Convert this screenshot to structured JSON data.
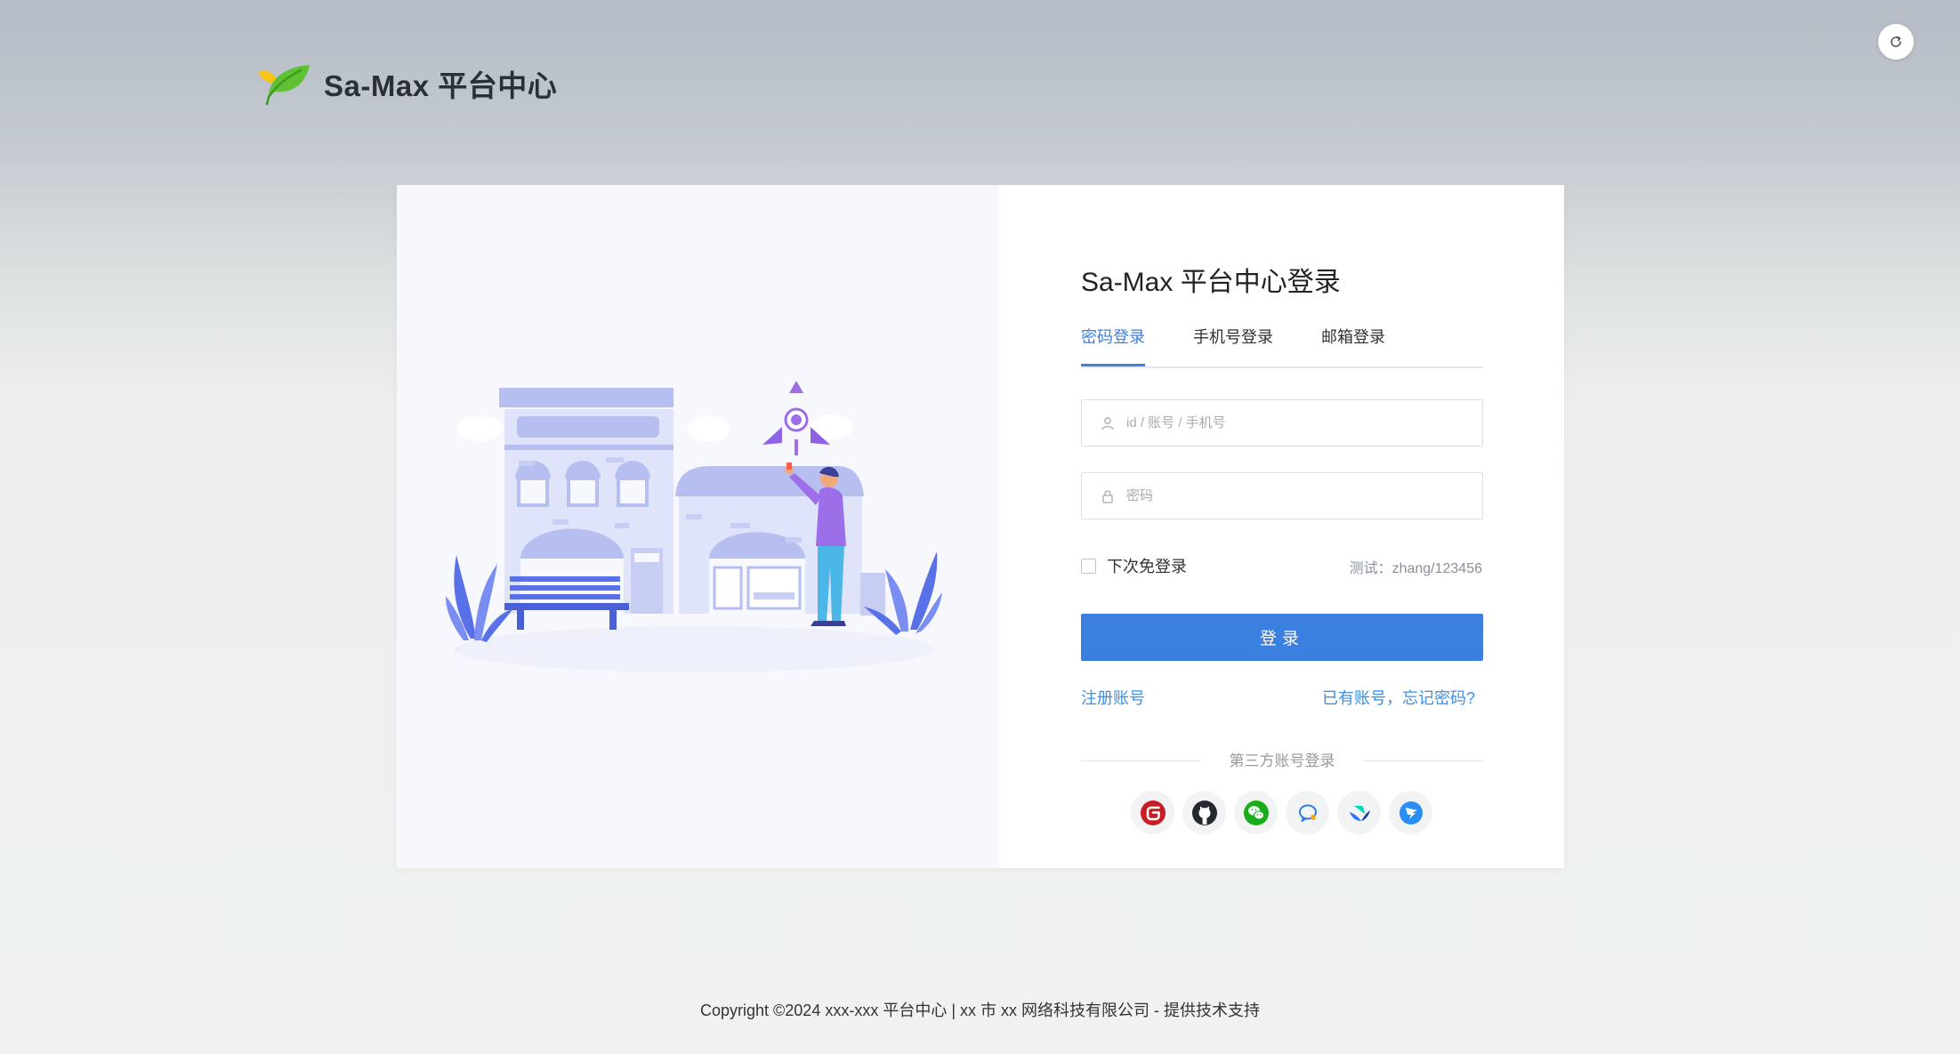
{
  "brand": {
    "name": "Sa-Max 平台中心"
  },
  "login": {
    "title": "Sa-Max 平台中心登录",
    "tabs": [
      {
        "label": "密码登录",
        "active": true
      },
      {
        "label": "手机号登录",
        "active": false
      },
      {
        "label": "邮箱登录",
        "active": false
      }
    ],
    "account_placeholder": "id / 账号 / 手机号",
    "password_placeholder": "密码",
    "remember_label": "下次免登录",
    "remember_checked": false,
    "test_hint": "测试：zhang/123456",
    "submit_label": "登录",
    "register_link": "注册账号",
    "forgot_link": "已有账号，忘记密码?",
    "third_party_title": "第三方账号登录",
    "third_party_icons": [
      "gitee-icon",
      "github-icon",
      "wechat-icon",
      "qq-icon",
      "feishu-icon",
      "dingtalk-icon"
    ]
  },
  "footer": {
    "text": "Copyright ©2024 xxx-xxx 平台中心 | xx 市 xx 网络科技有限公司 - 提供技术支持"
  },
  "colors": {
    "primary": "#3b7fe0",
    "link": "#3b8fe6",
    "illustration": "#b7bff0",
    "illustration_dark": "#7d6ee0"
  }
}
